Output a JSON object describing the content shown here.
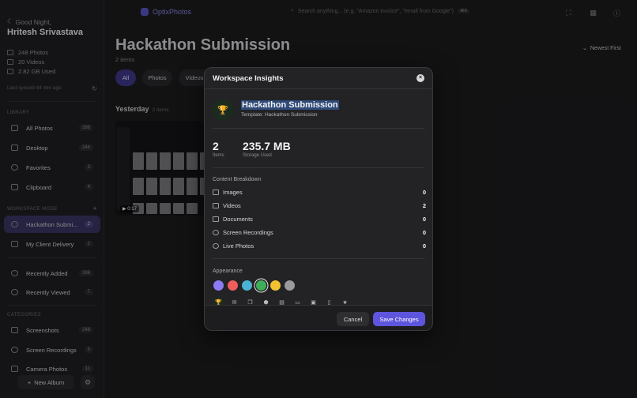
{
  "sidebar": {
    "greeting": "Good Night,",
    "user_name": "Hritesh Srivastava",
    "stats": [
      "248 Photos",
      "20 Videos",
      "2.82 GB Used"
    ],
    "synced": "Last synced 44 min ago",
    "library_label": "LIBRARY",
    "library": [
      {
        "label": "All Photos",
        "count": "268"
      },
      {
        "label": "Desktop",
        "count": "244"
      },
      {
        "label": "Favorites",
        "count": "3"
      },
      {
        "label": "Clipboard",
        "count": "4"
      }
    ],
    "workspace_label": "WORKSPACE MODE",
    "workspaces": [
      {
        "label": "Hackathon Submi...",
        "count": "2"
      },
      {
        "label": "My Client Delivery",
        "count": "2"
      }
    ],
    "recent": [
      {
        "label": "Recently Added",
        "count": "266"
      },
      {
        "label": "Recently Viewed",
        "count": "7"
      }
    ],
    "categories_label": "CATEGORIES",
    "categories": [
      {
        "label": "Screenshots",
        "count": "248"
      },
      {
        "label": "Screen Recordings",
        "count": "5"
      },
      {
        "label": "Camera Photos",
        "count": "11"
      }
    ],
    "new_album": "New Album"
  },
  "topbar": {
    "logo": "OptixPhotos",
    "search_placeholder": "Search anything... (e.g. \"Amazon invoice\", \"email from Google\")",
    "search_kbd": "⌘K"
  },
  "main": {
    "title": "Hackathon Submission",
    "subtitle": "2 items",
    "sort": "Newest First",
    "chips": [
      "All",
      "Photos",
      "Videos"
    ],
    "day": "Yesterday",
    "day_count": "2 items",
    "video_duration": "▶ 0:17"
  },
  "modal": {
    "title": "Workspace Insights",
    "workspace_name": "Hackathon Submission",
    "template": "Template: Hackathon Submission",
    "items_value": "2",
    "items_label": "Items",
    "storage_value": "235.7 MB",
    "storage_label": "Storage Used",
    "breakdown_label": "Content Breakdown",
    "breakdown": [
      {
        "label": "Images",
        "value": "0"
      },
      {
        "label": "Videos",
        "value": "2"
      },
      {
        "label": "Documents",
        "value": "0"
      },
      {
        "label": "Screen Recordings",
        "value": "0"
      },
      {
        "label": "Live Photos",
        "value": "0"
      }
    ],
    "appearance_label": "Appearance",
    "colors": [
      "#8b7cf6",
      "#ef5d5d",
      "#4ab3d4",
      "#3fae5a",
      "#f2c230",
      "#9a9a9e"
    ],
    "selected_color": "#3fae5a",
    "icons": [
      "trophy-icon",
      "mail-icon",
      "copy-icon",
      "box-icon",
      "document-icon",
      "folder-icon",
      "archive-icon",
      "file-icon",
      "star-icon"
    ],
    "cancel": "Cancel",
    "save": "Save Changes"
  }
}
